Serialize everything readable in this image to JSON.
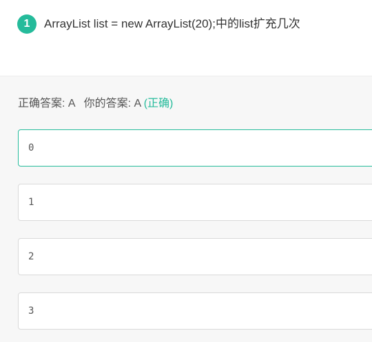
{
  "question": {
    "number": "1",
    "text": "ArrayList list = new ArrayList(20);中的list扩充几次"
  },
  "answer": {
    "correct_label": "正确答案: A",
    "yours_label": "你的答案: A",
    "status": "(正确)"
  },
  "options": [
    {
      "text": "0",
      "selected": true
    },
    {
      "text": "1",
      "selected": false
    },
    {
      "text": "2",
      "selected": false
    },
    {
      "text": "3",
      "selected": false
    }
  ],
  "colors": {
    "accent": "#25bb9b",
    "option_border": "#d9d9d9",
    "background": "#f7f7f7"
  }
}
